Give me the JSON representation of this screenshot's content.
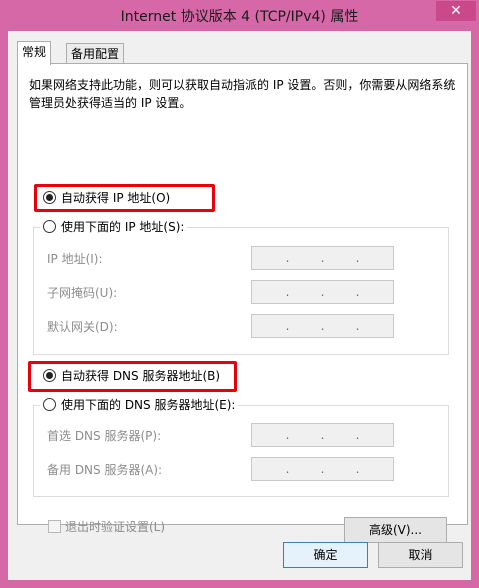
{
  "window": {
    "title": "Internet 协议版本 4 (TCP/IPv4) 属性",
    "close_glyph": "✕"
  },
  "tabs": [
    {
      "label": "常规",
      "active": true
    },
    {
      "label": "备用配置",
      "active": false
    }
  ],
  "description": "如果网络支持此功能，则可以获取自动指派的 IP 设置。否则，你需要从网络系统管理员处获得适当的 IP 设置。",
  "ip_section": {
    "auto_label": "自动获得 IP 地址(O)",
    "manual_label": "使用下面的 IP 地址(S):",
    "selected": "auto",
    "fields": [
      {
        "label": "IP 地址(I):",
        "value": [
          ". ",
          ". ",
          ". "
        ]
      },
      {
        "label": "子网掩码(U):",
        "value": [
          ". ",
          ". ",
          ". "
        ]
      },
      {
        "label": "默认网关(D):",
        "value": [
          ". ",
          ". ",
          ". "
        ]
      }
    ]
  },
  "dns_section": {
    "auto_label": "自动获得 DNS 服务器地址(B)",
    "manual_label": "使用下面的 DNS 服务器地址(E):",
    "selected": "auto",
    "fields": [
      {
        "label": "首选 DNS 服务器(P):",
        "value": [
          ". ",
          ". ",
          ". "
        ]
      },
      {
        "label": "备用 DNS 服务器(A):",
        "value": [
          ". ",
          ". ",
          ". "
        ]
      }
    ]
  },
  "validate_checkbox": {
    "label": "退出时验证设置(L)",
    "checked": false
  },
  "advanced_button": "高级(V)...",
  "ok_button": "确定",
  "cancel_button": "取消",
  "colors": {
    "frame": "#d768a8",
    "highlight": "#e8000b",
    "close_button": "#c9498a"
  }
}
